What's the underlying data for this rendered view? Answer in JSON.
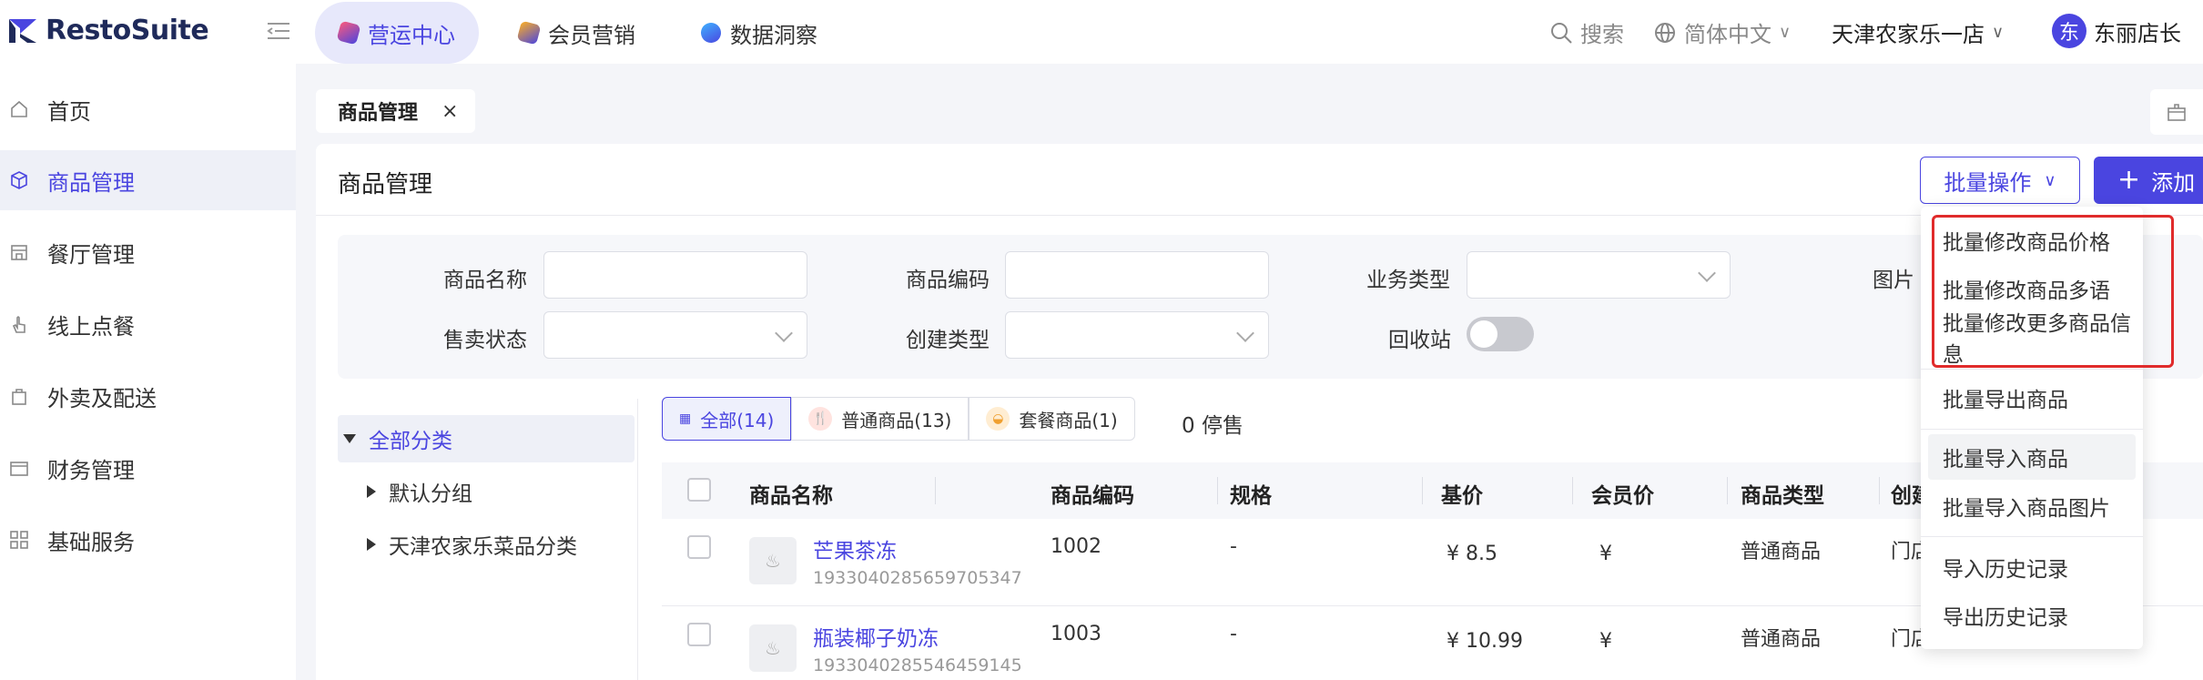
{
  "brand": {
    "name": "RestoSuite",
    "accent": "#4a45e0"
  },
  "topnav": {
    "tabs": [
      {
        "label": "营运中心",
        "active": true,
        "icon": "operations-icon"
      },
      {
        "label": "会员营销",
        "active": false,
        "icon": "marketing-icon"
      },
      {
        "label": "数据洞察",
        "active": false,
        "icon": "insights-icon"
      }
    ],
    "search_label": "搜索",
    "language": "简体中文",
    "store": "天津农家乐一店",
    "user_initial": "东",
    "user_name": "东丽店长"
  },
  "sidebar": {
    "items": [
      {
        "label": "首页",
        "icon": "home-icon",
        "active": false
      },
      {
        "label": "商品管理",
        "icon": "box-icon",
        "active": true
      },
      {
        "label": "餐厅管理",
        "icon": "store-icon",
        "active": false
      },
      {
        "label": "线上点餐",
        "icon": "hand-pointer-icon",
        "active": false
      },
      {
        "label": "外卖及配送",
        "icon": "bag-icon",
        "active": false
      },
      {
        "label": "财务管理",
        "icon": "wallet-icon",
        "active": false
      },
      {
        "label": "基础服务",
        "icon": "grid-icon",
        "active": false
      }
    ]
  },
  "page_tab": {
    "label": "商品管理",
    "close": "×"
  },
  "main": {
    "title": "商品管理",
    "batch_button": "批量操作",
    "add_button": "添加",
    "filters": {
      "product_name": "商品名称",
      "product_code": "商品编码",
      "business_type": "业务类型",
      "image": "图片",
      "sale_status": "售卖状态",
      "create_type": "创建类型",
      "recycle_bin": "回收站"
    },
    "tree": {
      "all": "全部分类",
      "children": [
        "默认分组",
        "天津农家乐菜品分类"
      ]
    },
    "type_tabs": [
      "全部(14)",
      "普通商品(13)",
      "套餐商品(1)"
    ],
    "stop_count": "0 停售",
    "table": {
      "headers": [
        "商品名称",
        "商品编码",
        "规格",
        "基价",
        "会员价",
        "商品类型",
        "创建"
      ],
      "rows": [
        {
          "name": "芒果茶冻",
          "id": "1933040285659705347",
          "code": "1002",
          "spec": "-",
          "price": "¥  8.5",
          "member_price": "¥",
          "type": "普通商品",
          "creator": "门店"
        },
        {
          "name": "瓶装椰子奶冻",
          "id": "1933040285546459145",
          "code": "1003",
          "spec": "-",
          "price": "¥  10.99",
          "member_price": "¥",
          "type": "普通商品",
          "creator": "门店"
        }
      ]
    }
  },
  "dropdown": {
    "highlighted_items": [
      "批量修改商品价格",
      "批量修改商品多语",
      "批量修改更多商品信息"
    ],
    "export_item": "批量导出商品",
    "import_items": [
      "批量导入商品",
      "批量导入商品图片"
    ],
    "history_items": [
      "导入历史记录",
      "导出历史记录"
    ]
  }
}
